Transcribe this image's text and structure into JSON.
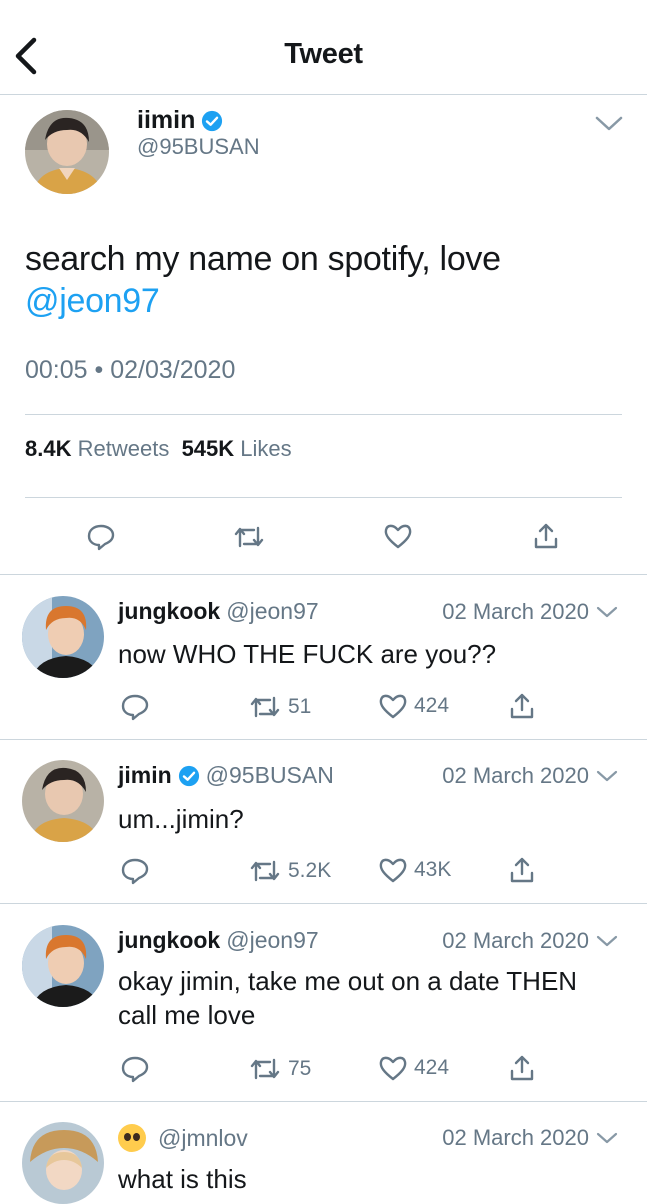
{
  "header": {
    "title": "Tweet"
  },
  "main_tweet": {
    "name": "iimin",
    "handle": "@95BUSAN",
    "text": "search my name on spotify, love",
    "mention": "@jeon97",
    "time": "00:05",
    "separator": "•",
    "date": "02/03/2020",
    "retweets_count": "8.4K",
    "retweets_label": "Retweets",
    "likes_count": "545K",
    "likes_label": "Likes"
  },
  "replies": [
    {
      "name": "jungkook",
      "handle": "@jeon97",
      "date": "02 March 2020",
      "text": "now WHO THE FUCK are you??",
      "retweets": "51",
      "likes": "424",
      "verified": false
    },
    {
      "name": "jimin",
      "handle": "@95BUSAN",
      "date": "02 March 2020",
      "text": "um...jimin?",
      "retweets": "5.2K",
      "likes": "43K",
      "verified": true
    },
    {
      "name": "jungkook",
      "handle": "@jeon97",
      "date": "02 March 2020",
      "text": "okay jimin, take me out on a date THEN call me love",
      "retweets": "75",
      "likes": "424",
      "verified": false
    },
    {
      "name": "",
      "handle": "@jmnlov",
      "date": "02 March 2020",
      "text": "what is this",
      "name_icon": "pleading-face-emoji"
    }
  ],
  "colors": {
    "accent": "#1da1f2",
    "secondary_text": "#657786",
    "divider": "#ccd6dd"
  },
  "icons": [
    "back-arrow-icon",
    "verified-badge-icon",
    "chevron-down-icon",
    "reply-icon",
    "retweet-icon",
    "like-icon",
    "share-icon"
  ]
}
